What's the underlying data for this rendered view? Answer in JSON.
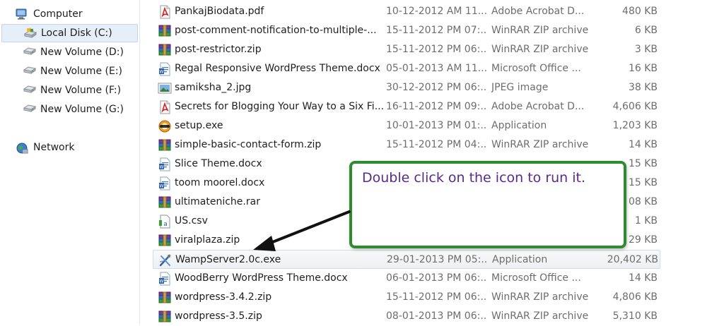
{
  "nav": {
    "items": [
      {
        "label": "Computer",
        "icon": "computer-icon"
      },
      {
        "label": "Local Disk (C:)",
        "icon": "local-disk-icon",
        "selected": true
      },
      {
        "label": "New Volume (D:)",
        "icon": "drive-icon"
      },
      {
        "label": "New Volume (E:)",
        "icon": "drive-icon"
      },
      {
        "label": "New Volume (F:)",
        "icon": "drive-icon"
      },
      {
        "label": "New Volume (G:)",
        "icon": "drive-icon"
      },
      {
        "label": "Network",
        "icon": "network-icon"
      }
    ]
  },
  "files": [
    {
      "name": "PankajBiodata.pdf",
      "date": "10-12-2012 AM 11...",
      "type": "Adobe Acrobat D...",
      "size": "480 KB",
      "icon": "pdf-icon"
    },
    {
      "name": "post-comment-notification-to-multiple-...",
      "date": "15-11-2012 PM 07:...",
      "type": "WinRAR ZIP archive",
      "size": "6 KB",
      "icon": "winrar-icon"
    },
    {
      "name": "post-restrictor.zip",
      "date": "15-11-2012 PM 06:...",
      "type": "WinRAR ZIP archive",
      "size": "3 KB",
      "icon": "winrar-icon"
    },
    {
      "name": "Regal Responsive WordPress Theme.docx",
      "date": "05-01-2013 AM 11...",
      "type": "Microsoft Office ...",
      "size": "16 KB",
      "icon": "docx-icon"
    },
    {
      "name": "samiksha_2.jpg",
      "date": "30-12-2012 PM 06:...",
      "type": "JPEG image",
      "size": "38 KB",
      "icon": "jpg-icon"
    },
    {
      "name": "Secrets for Blogging Your Way to a Six Fi...",
      "date": "16-11-2012 PM 09:...",
      "type": "Adobe Acrobat D...",
      "size": "4,606 KB",
      "icon": "pdf-icon"
    },
    {
      "name": "setup.exe",
      "date": "10-01-2013 PM 01:...",
      "type": "Application",
      "size": "1,203 KB",
      "icon": "setup-exe-icon"
    },
    {
      "name": "simple-basic-contact-form.zip",
      "date": "15-11-2012 PM 04:...",
      "type": "WinRAR ZIP archive",
      "size": "14 KB",
      "icon": "winrar-icon"
    },
    {
      "name": "Slice Theme.docx",
      "date": "",
      "type": "",
      "size": "15 KB",
      "icon": "docx-icon"
    },
    {
      "name": "toom moorel.docx",
      "date": "",
      "type": "",
      "size": "15 KB",
      "icon": "docx-icon"
    },
    {
      "name": "ultimateniche.rar",
      "date": "",
      "type": "",
      "size": "08 KB",
      "icon": "winrar-icon"
    },
    {
      "name": "US.csv",
      "date": "",
      "type": "",
      "size": "1 KB",
      "icon": "csv-icon"
    },
    {
      "name": "viralplaza.zip",
      "date": "",
      "type": "",
      "size": "29 KB",
      "icon": "winrar-icon"
    },
    {
      "name": "WampServer2.0c.exe",
      "date": "29-01-2013 PM 05:...",
      "type": "Application",
      "size": "20,402 KB",
      "icon": "wampserver-icon",
      "highlighted": true
    },
    {
      "name": "WoodBerry WordPress Theme.docx",
      "date": "06-01-2013 PM 06:...",
      "type": "Microsoft Office ...",
      "size": "14 KB",
      "icon": "docx-icon"
    },
    {
      "name": "wordpress-3.4.2.zip",
      "date": "15-11-2012 PM 06:...",
      "type": "WinRAR ZIP archive",
      "size": "4,806 KB",
      "icon": "winrar-icon"
    },
    {
      "name": "wordpress-3.5.zip",
      "date": "08-01-2013 PM 06:...",
      "type": "WinRAR ZIP archive",
      "size": "5,310 KB",
      "icon": "winrar-icon"
    }
  ],
  "callout": {
    "text": "Double click on the icon to run it.",
    "border_color": "#2e8b2e",
    "text_color": "#5a2a8a"
  },
  "colors": {
    "hover_row": "#eef1f4",
    "nav_selected": "#e6eef8",
    "secondary_text": "#6d6d6d"
  }
}
